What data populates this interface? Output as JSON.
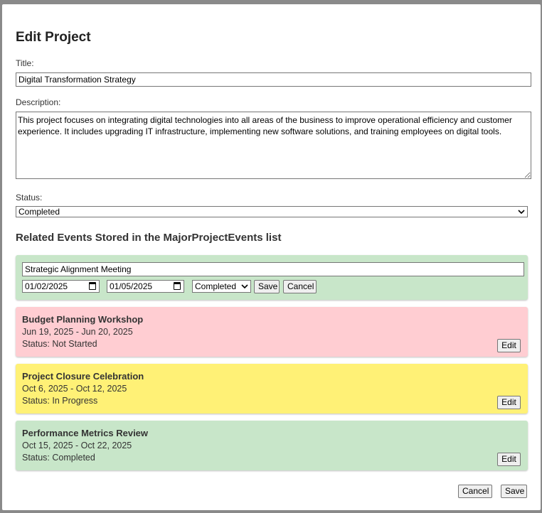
{
  "dialog": {
    "title": "Edit Project",
    "title_label": "Title:",
    "title_value": "Digital Transformation Strategy",
    "description_label": "Description:",
    "description_value": "This project focuses on integrating digital technologies into all areas of the business to improve operational efficiency and customer experience. It includes upgrading IT infrastructure, implementing new software solutions, and training employees on digital tools.",
    "status_label": "Status:",
    "status_value": "Completed",
    "events_heading": "Related Events Stored in the MajorProjectEvents list",
    "cancel_label": "Cancel",
    "save_label": "Save"
  },
  "editing_event": {
    "title_value": "Strategic Alignment Meeting",
    "start_date": "01/02/2025",
    "end_date": "01/05/2025",
    "status_value": "Completed",
    "save_label": "Save",
    "cancel_label": "Cancel",
    "color": "#c8e6c9"
  },
  "events": [
    {
      "title": "Budget Planning Workshop",
      "dates": "Jun 19, 2025 - Jun 20, 2025",
      "status": "Status: Not Started",
      "edit_label": "Edit",
      "color": "#ffcdd2"
    },
    {
      "title": "Project Closure Celebration",
      "dates": "Oct 6, 2025 - Oct 12, 2025",
      "status": "Status: In Progress",
      "edit_label": "Edit",
      "color": "#fff176"
    },
    {
      "title": "Performance Metrics Review",
      "dates": "Oct 15, 2025 - Oct 22, 2025",
      "status": "Status: Completed",
      "edit_label": "Edit",
      "color": "#c8e6c9"
    }
  ],
  "icons": {
    "select_chevron": "chevron-down-icon",
    "date_picker": "calendar-icon"
  }
}
